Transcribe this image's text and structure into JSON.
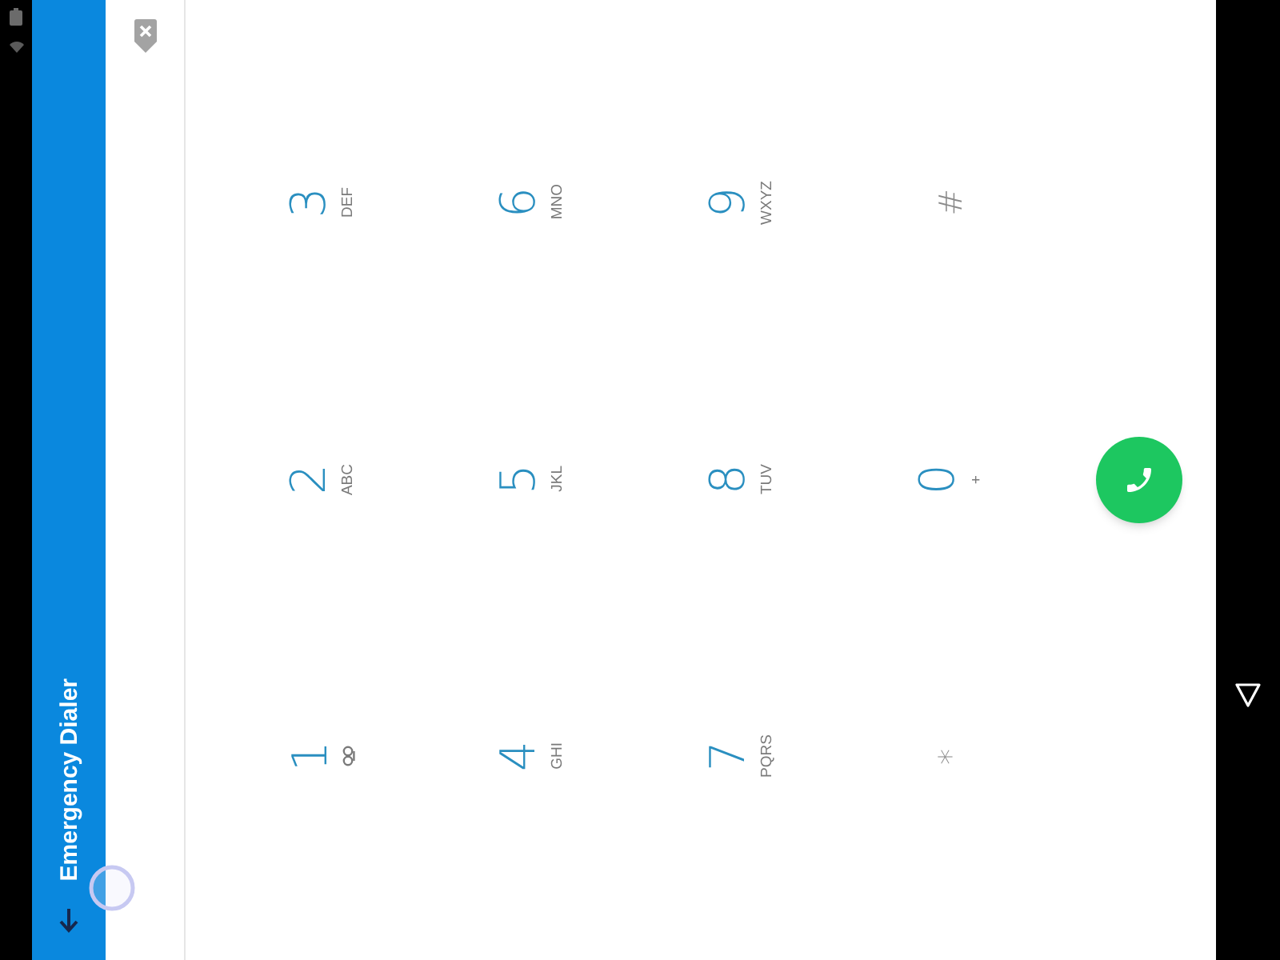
{
  "header": {
    "title": "Emergency Dialer"
  },
  "keypad": {
    "columns": [
      [
        {
          "kind": "digit",
          "digit": "3",
          "letters": "DEF"
        },
        {
          "kind": "digit",
          "digit": "2",
          "letters": "ABC"
        },
        {
          "kind": "voicemail",
          "digit": "1"
        }
      ],
      [
        {
          "kind": "digit",
          "digit": "6",
          "letters": "MNO"
        },
        {
          "kind": "digit",
          "digit": "5",
          "letters": "JKL"
        },
        {
          "kind": "digit",
          "digit": "4",
          "letters": "GHI"
        }
      ],
      [
        {
          "kind": "digit",
          "digit": "9",
          "letters": "WXYZ"
        },
        {
          "kind": "digit",
          "digit": "8",
          "letters": "TUV"
        },
        {
          "kind": "digit",
          "digit": "7",
          "letters": "PQRS"
        }
      ],
      [
        {
          "kind": "symbol",
          "digit": "#"
        },
        {
          "kind": "digit",
          "digit": "0",
          "letters": "+"
        },
        {
          "kind": "symbol",
          "digit": "*"
        }
      ]
    ]
  }
}
